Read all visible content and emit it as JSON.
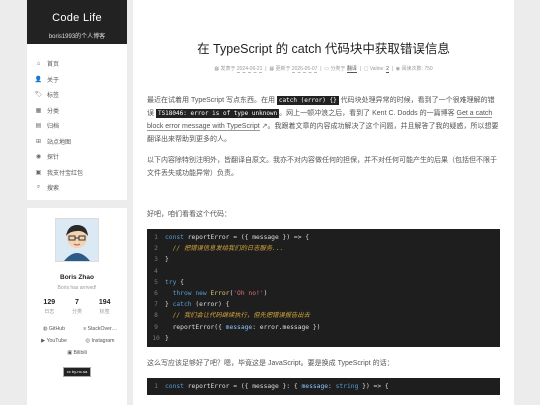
{
  "site": {
    "title": "Code Life",
    "subtitle": "boris1993的个人博客"
  },
  "menu": [
    {
      "icon": "home-icon",
      "glyph": "⌂",
      "label": "首页"
    },
    {
      "icon": "user-icon",
      "glyph": "👤",
      "label": "关于"
    },
    {
      "icon": "tag-icon",
      "glyph": "🏷",
      "label": "标签"
    },
    {
      "icon": "category-icon",
      "glyph": "▦",
      "label": "分类"
    },
    {
      "icon": "archive-icon",
      "glyph": "▤",
      "label": "归档"
    },
    {
      "icon": "sitemap-icon",
      "glyph": "⊞",
      "label": "站点地图"
    },
    {
      "icon": "rss-icon",
      "glyph": "◉",
      "label": "探针"
    },
    {
      "icon": "wechat-pay-icon",
      "glyph": "▣",
      "label": "我支付宝红包"
    },
    {
      "icon": "search-icon",
      "glyph": "⌕",
      "label": "搜索"
    }
  ],
  "profile": {
    "name": "Boris Zhao",
    "motto": "Boris has arrived!",
    "stats": [
      {
        "value": "129",
        "label": "日志"
      },
      {
        "value": "7",
        "label": "分类"
      },
      {
        "value": "194",
        "label": "标签"
      }
    ],
    "social": [
      {
        "icon": "github-icon",
        "label": "GitHub"
      },
      {
        "icon": "stackoverflow-icon",
        "label": "StackOver…"
      },
      {
        "icon": "youtube-icon",
        "label": "YouTube"
      },
      {
        "icon": "instagram-icon",
        "label": "Instagram"
      },
      {
        "icon": "bilibili-icon",
        "label": "Bilibili"
      }
    ],
    "license": "cc by-nc-sa"
  },
  "post": {
    "title": "在 TypeScript 的 catch 代码块中获取错误信息",
    "meta": {
      "published_label": "发表于",
      "published": "2024-06-21",
      "updated_label": "更新于",
      "updated": "2026-05-07",
      "category_label": "分类于",
      "category": "翻译",
      "comments_label": "Valine:",
      "comments": "2",
      "views_label": "阅读次数:",
      "views": "750"
    },
    "para1": {
      "t1": "最近在试着用 TypeScript 写点东西。在用 ",
      "code1": "catch (error) {}",
      "t2": " 代码块处理异常的时候，看到了一个很难理解的错误 ",
      "code2": "TS18046: error is of type unknown",
      "t3": "。网上一顿冲浪之后，看到了 Kent C. Dodds 的一篇博客 ",
      "link": "Get a catch block error message with TypeScript",
      "t4": "。我跟着文章的内容成功解决了这个问题，并且解答了我的疑惑，所以想要翻译出来帮助到更多的人。"
    },
    "para2": "以下内容除特别注明外，皆翻译自原文。我亦不对内容做任何的担保，并不对任何可能产生的后果（包括但不限于文件丢失或功能异常）负责。",
    "para3": "好吧，咱们看看这个代码：",
    "para4": "这么写应该足够好了吧？嗯，毕竟这是 JavaScript。要是换成 TypeScript 的话："
  },
  "code1": [
    {
      "n": "1",
      "tokens": [
        [
          "kw",
          "const "
        ],
        [
          "",
          "reportError = ({ message }) => {"
        ]
      ]
    },
    {
      "n": "2",
      "tokens": [
        [
          "cm",
          "  // 把错误信息发给我们的日志服务..."
        ]
      ]
    },
    {
      "n": "3",
      "tokens": [
        [
          "",
          "}"
        ]
      ]
    },
    {
      "n": "4",
      "tokens": [
        [
          "",
          ""
        ]
      ]
    },
    {
      "n": "5",
      "tokens": [
        [
          "kw",
          "try"
        ],
        [
          "",
          " {"
        ]
      ]
    },
    {
      "n": "6",
      "tokens": [
        [
          "kw",
          "  throw new "
        ],
        [
          "fn",
          "Error"
        ],
        [
          "",
          "("
        ],
        [
          "st",
          "'Oh no!'"
        ],
        [
          "",
          ")"
        ]
      ]
    },
    {
      "n": "7",
      "tokens": [
        [
          "",
          "} "
        ],
        [
          "kw",
          "catch"
        ],
        [
          "",
          " (error) {"
        ]
      ]
    },
    {
      "n": "8",
      "tokens": [
        [
          "cm",
          "  // 我们会让代码继续执行，但先把错误报告出去"
        ]
      ]
    },
    {
      "n": "9",
      "tokens": [
        [
          "",
          "  reportError({ "
        ],
        [
          "pr",
          "message"
        ],
        [
          "",
          ": error.message })"
        ]
      ]
    },
    {
      "n": "10",
      "tokens": [
        [
          "",
          "}"
        ]
      ]
    }
  ],
  "code2": [
    {
      "n": "1",
      "tokens": [
        [
          "kw",
          "const "
        ],
        [
          "",
          "reportError = ({ message }: { "
        ],
        [
          "pr",
          "message"
        ],
        [
          "",
          ": "
        ],
        [
          "kw",
          "string"
        ],
        [
          "",
          " }) => {"
        ]
      ]
    }
  ]
}
